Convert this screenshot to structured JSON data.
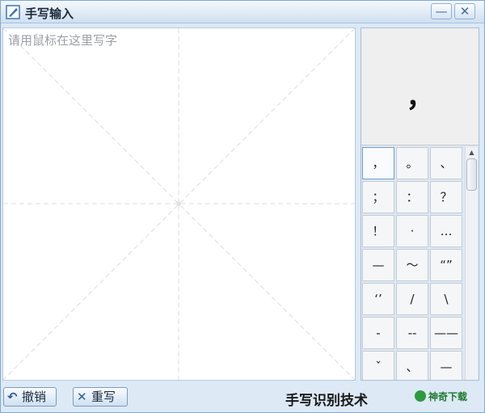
{
  "window": {
    "title": "手写输入",
    "minimize_glyph": "—",
    "close_glyph": "✕"
  },
  "canvas": {
    "hint": "请用鼠标在这里写字"
  },
  "preview": {
    "char": "，"
  },
  "candidates": [
    "，",
    "。",
    "、",
    "；",
    "：",
    "？",
    "！",
    "·",
    "…",
    "—",
    "～",
    "“”",
    "‘’",
    "/",
    "\\",
    "-",
    "--",
    "——",
    "ˇ",
    "、",
    "—"
  ],
  "scrollbar": {
    "up_glyph": "▲"
  },
  "bottom": {
    "undo_label": "撤销",
    "rewrite_label": "重写",
    "tech_label": "手写识别技术",
    "brand_label": "神奇下载"
  },
  "colors": {
    "title_bar": "#cfe0f0",
    "frame": "#dde9f5",
    "accent": "#2f5f92",
    "brand": "#2c9a41"
  }
}
